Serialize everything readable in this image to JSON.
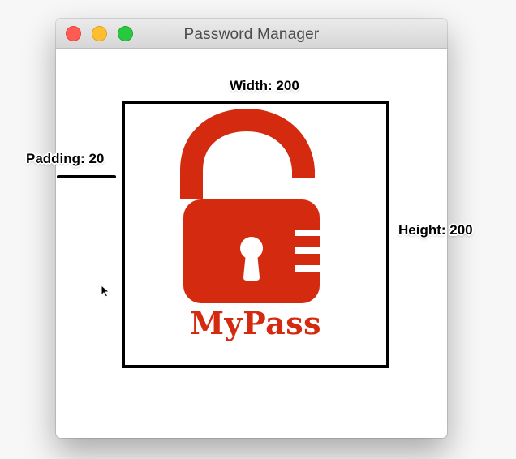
{
  "window": {
    "title": "Password Manager"
  },
  "annotations": {
    "width": "Width: 200",
    "height": "Height: 200",
    "padding": "Padding: 20"
  },
  "logo": {
    "text": "MyPass",
    "icon": "unlocked-padlock-icon",
    "color": "#d42a0f"
  },
  "colors": {
    "close": "#ff5b52",
    "minimize": "#ffbe2f",
    "maximize": "#29c93f"
  }
}
